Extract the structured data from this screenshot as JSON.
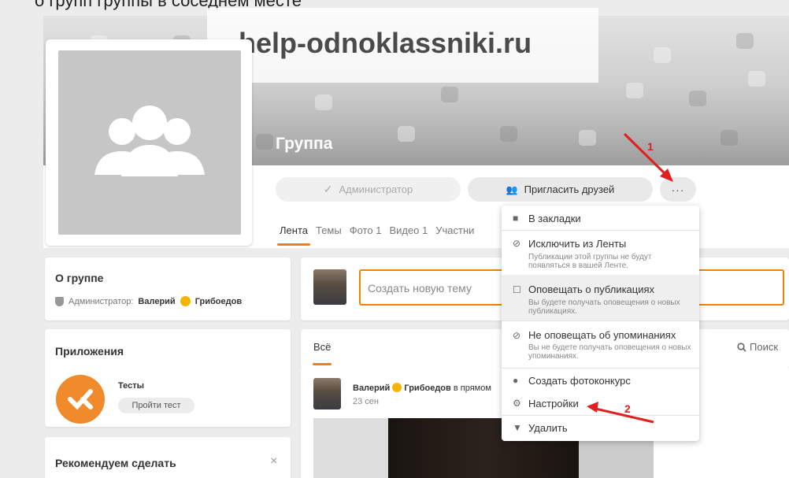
{
  "page_caption": "о групп группы в соседнем месте",
  "watermark": "help-odnoklassniki.ru",
  "group": {
    "title": "Группа",
    "admin_button": "Администратор",
    "invite_button": "Пригласить друзей",
    "more_button": "···"
  },
  "tabs": [
    {
      "label": "Лента"
    },
    {
      "label": "Темы"
    },
    {
      "label": "Фото 1"
    },
    {
      "label": "Видео 1"
    },
    {
      "label": "Участни"
    }
  ],
  "about": {
    "title": "О группе",
    "admin_prefix": "Администратор:",
    "admin_first": "Валерий",
    "admin_last": "Грибоедов"
  },
  "apps": {
    "title": "Приложения",
    "app_name": "Тесты",
    "app_button": "Пройти тест"
  },
  "recommend": {
    "title": "Рекомендуем сделать",
    "close": "×"
  },
  "composer": {
    "placeholder": "Создать новую тему"
  },
  "feed": {
    "filter_all": "Всё",
    "search": "Поиск"
  },
  "post": {
    "author_first": "Валерий",
    "author_last": "Грибоедов",
    "suffix": "в прямом",
    "date": "23 сен"
  },
  "menu": {
    "items": [
      {
        "label": "В закладки",
        "desc": ""
      },
      {
        "label": "Исключить из Ленты",
        "desc": "Публикации этой группы не будут появляться в вашей Ленте."
      },
      {
        "label": "Оповещать о публикациях",
        "desc": "Вы будете получать оповещения о новых публикациях."
      },
      {
        "label": "Не оповещать об упоминаниях",
        "desc": "Вы не будете получать оповещения о новых упоминаниях."
      },
      {
        "label": "Создать фотоконкурс",
        "desc": ""
      },
      {
        "label": "Настройки",
        "desc": ""
      },
      {
        "label": "Удалить",
        "desc": ""
      }
    ]
  },
  "annotations": {
    "step1": "1",
    "step2": "2"
  },
  "colors": {
    "accent": "#ee8208",
    "annotation": "#e02020",
    "highlight": "#efefef"
  }
}
